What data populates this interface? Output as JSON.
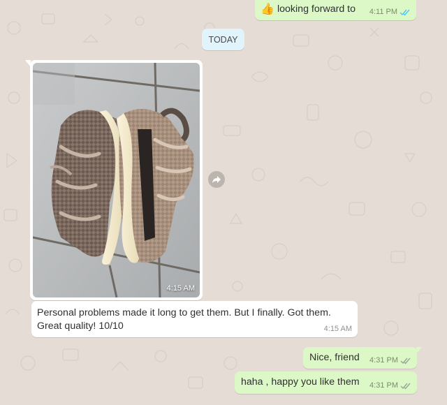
{
  "messages": {
    "top": {
      "emoji": "👍",
      "text": "looking forward to",
      "time": "4:11 PM"
    },
    "date_badge": "TODAY",
    "image_msg": {
      "time": "4:15 AM"
    },
    "caption_msg": {
      "text": "Personal problems made it long to get them. But I finally. Got them. Great quality! 10/10",
      "time": "4:15 AM"
    },
    "out1": {
      "text": "Nice, friend",
      "time": "4:31 PM"
    },
    "out2": {
      "text": "haha , happy you like them",
      "time": "4:31 PM"
    }
  },
  "icons": {
    "forward": "forward-icon",
    "read_receipt": "double-check-icon"
  },
  "colors": {
    "chat_bg": "#e5ddd5",
    "outgoing_bubble": "#dcf8c6",
    "incoming_bubble": "#ffffff",
    "date_badge_bg": "#e1f3fb",
    "read_tick": "#4fc3f7",
    "delivered_tick": "#9aa39a"
  }
}
